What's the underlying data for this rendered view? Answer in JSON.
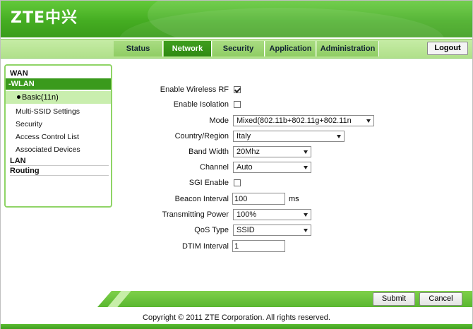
{
  "header": {
    "logo_text": "ZTE中兴"
  },
  "nav": {
    "tabs": [
      {
        "label": "Status"
      },
      {
        "label": "Network"
      },
      {
        "label": "Security"
      },
      {
        "label": "Application"
      },
      {
        "label": "Administration"
      }
    ],
    "active_tab": "Network",
    "logout_label": "Logout"
  },
  "sidebar": {
    "wan": "WAN",
    "wlan": "-WLAN",
    "wlan_items": [
      "Basic(11n)",
      "Multi-SSID Settings",
      "Security",
      "Access Control List",
      "Associated Devices"
    ],
    "lan": "LAN",
    "routing": "Routing"
  },
  "form": {
    "enable_wireless_rf": {
      "label": "Enable Wireless RF",
      "checked": true
    },
    "enable_isolation": {
      "label": "Enable Isolation",
      "checked": false
    },
    "mode": {
      "label": "Mode",
      "value": "Mixed(802.11b+802.11g+802.11n"
    },
    "country": {
      "label": "Country/Region",
      "value": "Italy"
    },
    "band_width": {
      "label": "Band Width",
      "value": "20Mhz"
    },
    "channel": {
      "label": "Channel",
      "value": "Auto"
    },
    "sgi_enable": {
      "label": "SGI Enable",
      "checked": false
    },
    "beacon_interval": {
      "label": "Beacon Interval",
      "value": "100",
      "unit": "ms"
    },
    "transmitting_power": {
      "label": "Transmitting Power",
      "value": "100%"
    },
    "qos_type": {
      "label": "QoS Type",
      "value": "SSID"
    },
    "dtim_interval": {
      "label": "DTIM Interval",
      "value": "1"
    }
  },
  "buttons": {
    "submit": "Submit",
    "cancel": "Cancel"
  },
  "footer": {
    "copyright": "Copyright © 2011 ZTE Corporation. All rights reserved."
  },
  "colors": {
    "brand_green": "#45ad22",
    "active_tab": "#2f8a12",
    "nav_bg": "#b0e08a",
    "sidebar_selected": "#c9eeae"
  }
}
